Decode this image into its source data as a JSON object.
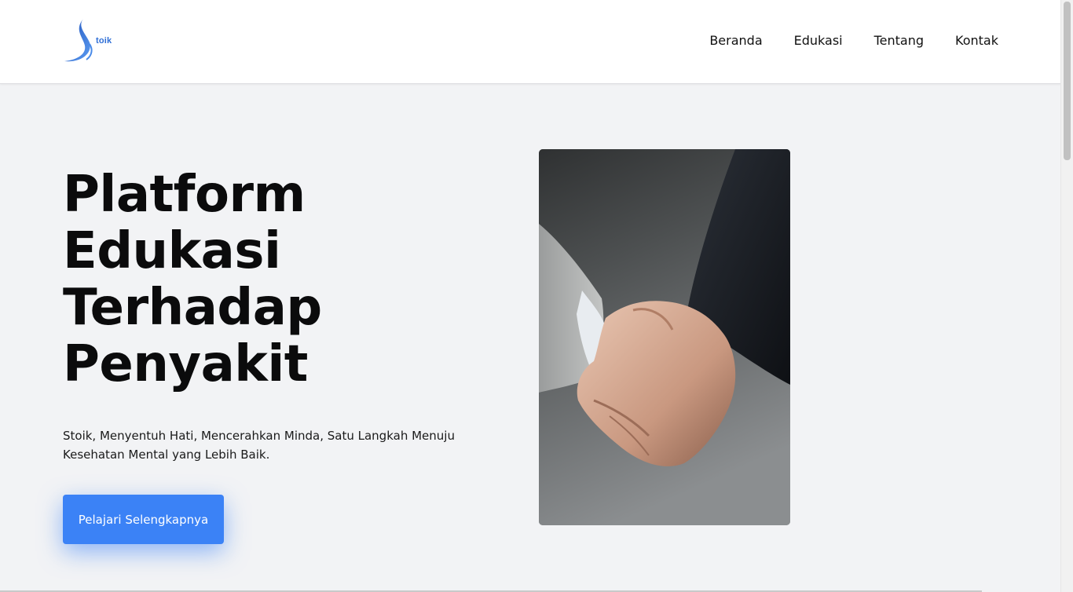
{
  "brand": {
    "logo_text": "toik",
    "accent_color": "#3b82f6"
  },
  "nav": {
    "items": [
      {
        "label": "Beranda"
      },
      {
        "label": "Edukasi"
      },
      {
        "label": "Tentang"
      },
      {
        "label": "Kontak"
      }
    ]
  },
  "hero": {
    "title_lines": [
      "Platform",
      "Edukasi",
      "Terhadap",
      "Penyakit"
    ],
    "subtitle": "Stoik, Menyentuh Hati, Mencerahkan Minda, Satu Langkah Menuju Kesehatan Mental yang Lebih Baik.",
    "cta_label": "Pelajari Selengkapnya",
    "image_subject": "handshake-photo"
  }
}
